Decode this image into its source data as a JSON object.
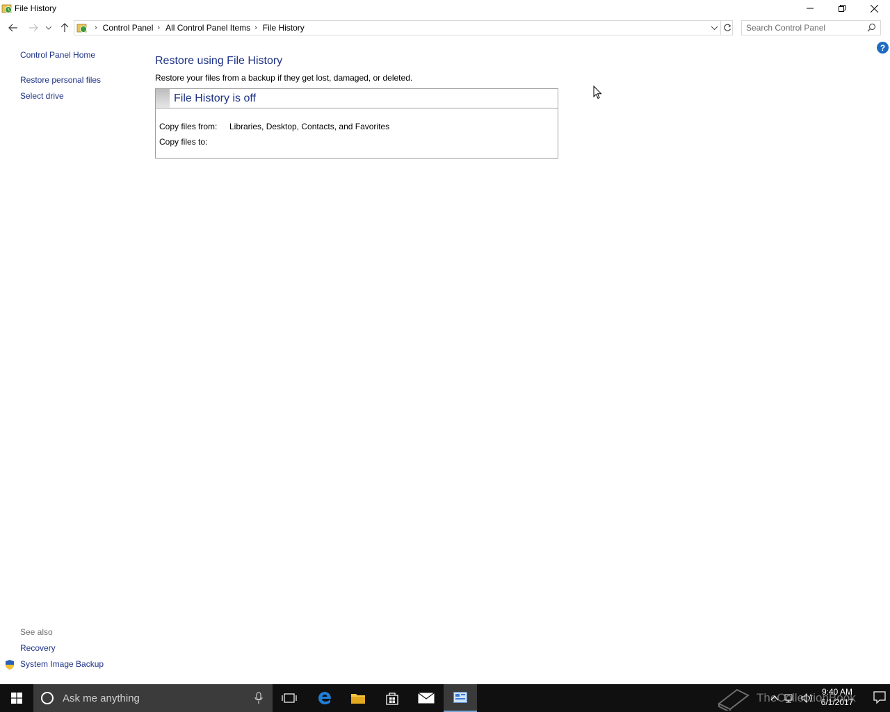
{
  "window": {
    "title": "File History",
    "controls": [
      "minimize-icon",
      "restore-icon",
      "close-icon"
    ]
  },
  "address": {
    "breadcrumbs": [
      "Control Panel",
      "All Control Panel Items",
      "File History"
    ],
    "search_placeholder": "Search Control Panel"
  },
  "sidebar": {
    "home": "Control Panel Home",
    "links": [
      "Restore personal files",
      "Select drive"
    ]
  },
  "see_also": {
    "header": "See also",
    "links": [
      "Recovery",
      "System Image Backup"
    ]
  },
  "main": {
    "heading": "Restore using File History",
    "subtitle": "Restore your files from a backup if they get lost, damaged, or deleted.",
    "status_title": "File History is off",
    "copy_from_label": "Copy files from:",
    "copy_from_value": "Libraries, Desktop, Contacts, and Favorites",
    "copy_to_label": "Copy files to:",
    "copy_to_value": ""
  },
  "help": {
    "label": "?"
  },
  "taskbar": {
    "search_placeholder": "Ask me anything",
    "time": "9:40 AM",
    "date": "6/1/2017",
    "apps": [
      "task-view-icon",
      "edge-icon",
      "file-explorer-icon",
      "store-icon",
      "mail-icon",
      "control-panel-icon"
    ],
    "watermark": "TheCollectionBook"
  },
  "colors": {
    "link": "#1e3287",
    "taskbar": "#101010",
    "help_badge": "#1f6bc2"
  }
}
